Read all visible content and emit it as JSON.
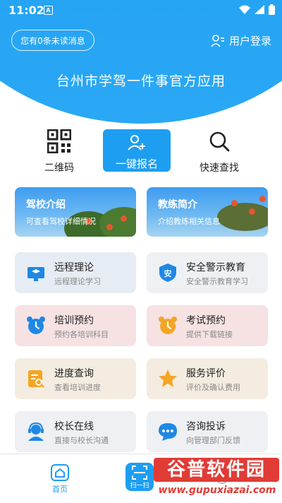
{
  "status_bar": {
    "time": "11:02",
    "notification_icon": "A"
  },
  "header": {
    "unread_messages": "您有0条未读消息",
    "login_label": "用户登录",
    "app_title": "台州市学驾一件事官方应用",
    "accent_color": "#1e9df2"
  },
  "quick_actions": {
    "qr": {
      "label": "二维码",
      "icon": "qr-code-icon"
    },
    "register": {
      "label": "一键报名",
      "icon": "add-user-icon"
    },
    "search": {
      "label": "快速查找",
      "icon": "search-icon"
    }
  },
  "banners": [
    {
      "title": "驾校介绍",
      "subtitle": "可查看驾校详细情况"
    },
    {
      "title": "教练简介",
      "subtitle": "介绍教练相关信息"
    }
  ],
  "cards": [
    {
      "title": "远程理论",
      "subtitle": "远程理论学习",
      "icon": "graduation-cap-icon"
    },
    {
      "title": "安全警示教育",
      "subtitle": "安全警示教育学习",
      "icon": "shield-icon",
      "icon_text": "安"
    },
    {
      "title": "培训预约",
      "subtitle": "预约各培训科目",
      "icon": "alarm-clock-icon"
    },
    {
      "title": "考试预约",
      "subtitle": "提供下载链接",
      "icon": "alarm-clock-icon"
    },
    {
      "title": "进度查询",
      "subtitle": "查看培训进度",
      "icon": "document-search-icon"
    },
    {
      "title": "服务评价",
      "subtitle": "评价及确认费用",
      "icon": "star-icon"
    },
    {
      "title": "校长在线",
      "subtitle": "直接与校长沟通",
      "icon": "headset-icon"
    },
    {
      "title": "咨询投诉",
      "subtitle": "向管理部门反馈",
      "icon": "chat-bubble-icon"
    }
  ],
  "tabbar": {
    "home_label": "首页",
    "scan_label": "扫一扫"
  },
  "watermark": {
    "title": "谷普软件园",
    "url": "www.gupuxiazai.com"
  }
}
